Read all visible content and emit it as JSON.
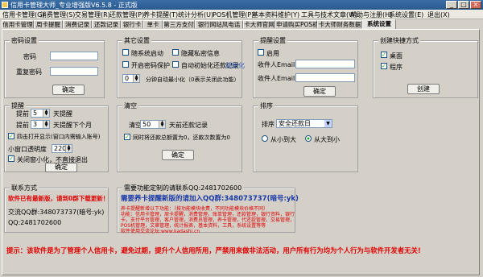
{
  "window": {
    "title": "信用卡管理大师_专业增强版V6.5.8 - 正式版",
    "minimize": "_",
    "maximize": "□",
    "close": "×"
  },
  "menu": [
    "信用卡管理(G)",
    "消费管理(S)",
    "交易管理(R)",
    "还款管理(P)",
    "养卡提醒(T)",
    "统计分析(U)",
    "POS机管理(P)",
    "基本资料维护(Y)",
    "工具与技术文章(W)",
    "帮助与注册(H)",
    "系统设置(E)",
    "退出(X)"
  ],
  "tabs": [
    "信用卡管理",
    "周卡提醒",
    "消费记录",
    "还款记录",
    "银行卡",
    "单卡",
    "第三方支付",
    "银行网站风电话",
    "卡大师官网",
    "申请购买POS机",
    "卡大师财务数据",
    "系统设置"
  ],
  "password": {
    "title": "密码设置",
    "password_label": "密码",
    "repeat_label": "重复密码",
    "confirm": "确定"
  },
  "other": {
    "title": "其它设置",
    "opt_startup": "随系统启动",
    "opt_hide_privacy": "隐藏私密信息",
    "opt_open_password": "开启密码保护",
    "opt_auto_record": "自动初始化还款记录",
    "init_link": "初始化",
    "minutes_value": "0",
    "auto_min_text": "分钟自动最小化（0表示关闭此功能）"
  },
  "reminder": {
    "title": "提醒设置",
    "enable": "启用",
    "email1_label": "收件人Email1:",
    "email2_label": "收件人Email2:",
    "confirm": "确定"
  },
  "skin": {
    "title": "创建快捷方式",
    "desktop": "桌面",
    "program": "程序",
    "create": "创建"
  },
  "remind": {
    "title": "提醒",
    "prefix1": "提前",
    "days_value": "5",
    "suffix1": "天提醒",
    "prefix2": "提前",
    "days2_value": "3",
    "suffix2": "天提醒下个月",
    "opt_check": "四击打开显示(窗口内需输入账号)",
    "transparency_label": "小窗口透明度",
    "transparency_value": "220",
    "opt_close": "关闭窗小化，不直接退出",
    "confirm": "确定"
  },
  "clear": {
    "title": "清空",
    "label": "清空",
    "days_value": "50",
    "suffix": "天前还款记录",
    "opt_limit": "同时将还款总额置为0，还款次数置为0",
    "confirm": "确定"
  },
  "sort": {
    "title": "排序",
    "label": "排序",
    "value": "安全还款日",
    "asc": "从小到大",
    "desc": "从大到小"
  },
  "contact": {
    "title": "联系方式",
    "notice": "软件已有最新版，请到0群下载更新！",
    "qq_label": "交流QQ群:348073737(暗号:yk)",
    "qq": "QQ:2481702600"
  },
  "ad": {
    "title": "需要功能定制的请联系QQ:2481702600",
    "headline": "需要养卡提醒新版的请加入QQ群:348073737(暗号:yk)",
    "lines": [
      "养卡提醒新增以下功能：（按功能模块收费，不同功能模块价格不同）",
      "功能：信用卡管理，周卡提醒，消费管理，账单管理，还款管理，银行资料，银行",
      "卡，支付平台管理，客户管理，消费员管理，养卡管理，代还款管理，交易管理，",
      "POS机管理，文章管理，统计报表，基本资料，工具，系统设置等等"
    ],
    "website": "软件使用交流论坛:www.kadashi.cn"
  },
  "footer": {
    "warning": "提示：该软件是为了管理个人信用卡，避免过期，提升个人信用所用，严禁用来做非法活动，用户所有行为均为个人行为与软件开发者无关!"
  },
  "colors": {
    "accent": "#3a6ea5",
    "warning": "#e00000",
    "headline": "#1a3aa8",
    "bg": "#d4d0c8"
  }
}
